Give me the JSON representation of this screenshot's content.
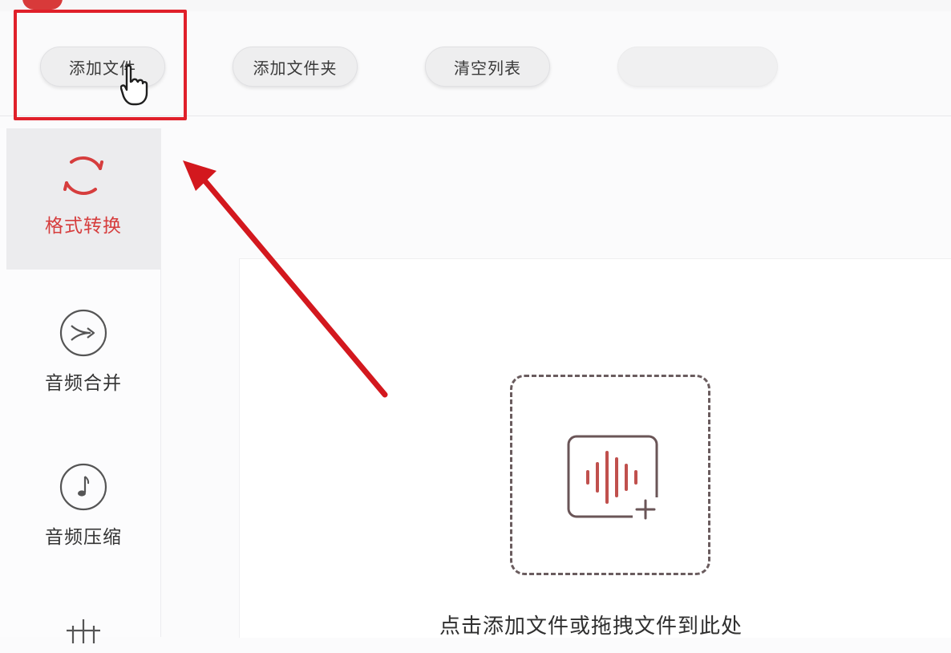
{
  "toolbar": {
    "add_file_label": "添加文件",
    "add_folder_label": "添加文件夹",
    "clear_list_label": "清空列表",
    "extra_label": ""
  },
  "sidebar": {
    "items": [
      {
        "label": "格式转换",
        "icon": "convert-cycle-icon",
        "active": true
      },
      {
        "label": "音频合并",
        "icon": "merge-arrows-icon",
        "active": false
      },
      {
        "label": "音频压缩",
        "icon": "music-note-icon",
        "active": false
      },
      {
        "label": "",
        "icon": "grid-icon",
        "active": false
      }
    ]
  },
  "dropzone": {
    "icon": "audio-add-icon",
    "hint": "点击添加文件或拖拽文件到此处"
  },
  "colors": {
    "accent": "#d63d3d",
    "highlight_box": "#e0202a",
    "annotation_arrow": "#d3181e"
  }
}
